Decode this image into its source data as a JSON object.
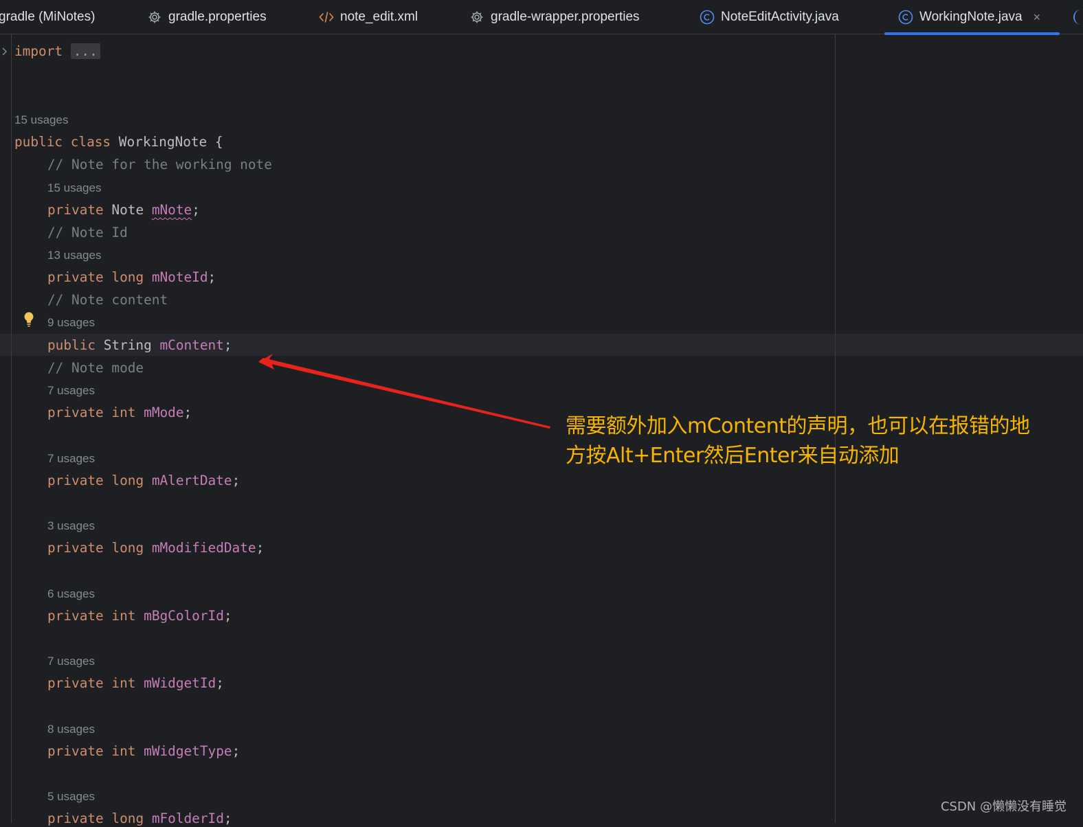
{
  "tabs": [
    {
      "label": "gradle (MiNotes)",
      "icon": "none",
      "active": false
    },
    {
      "label": "gradle.properties",
      "icon": "gear-icon",
      "active": false
    },
    {
      "label": "note_edit.xml",
      "icon": "xml-tag-icon",
      "active": false
    },
    {
      "label": "gradle-wrapper.properties",
      "icon": "gear-icon",
      "active": false
    },
    {
      "label": "NoteEditActivity.java",
      "icon": "java-class-icon",
      "active": false
    },
    {
      "label": "WorkingNote.java",
      "icon": "java-class-icon",
      "active": true,
      "close": "×"
    }
  ],
  "editor": {
    "import_keyword": "import",
    "import_folded": "...",
    "class_usages": "15 usages",
    "class_decl": {
      "mod": "public",
      "kw": "class",
      "name": "WorkingNote",
      "brace": " {"
    },
    "members": [
      {
        "comment": "// Note for the working note",
        "usages": "15 usages",
        "mod": "private",
        "type": "Note",
        "name": "mNote"
      },
      {
        "comment": "// Note Id",
        "usages": "13 usages",
        "mod": "private",
        "type": "long",
        "name": "mNoteId"
      },
      {
        "comment": "// Note content",
        "usages": "9 usages",
        "mod": "public",
        "type": "String",
        "name": "mContent"
      },
      {
        "comment": "// Note mode",
        "usages": "7 usages",
        "mod": "private",
        "type": "int",
        "name": "mMode"
      },
      {
        "comment": "",
        "usages": "7 usages",
        "mod": "private",
        "type": "long",
        "name": "mAlertDate"
      },
      {
        "comment": "",
        "usages": "3 usages",
        "mod": "private",
        "type": "long",
        "name": "mModifiedDate"
      },
      {
        "comment": "",
        "usages": "6 usages",
        "mod": "private",
        "type": "int",
        "name": "mBgColorId"
      },
      {
        "comment": "",
        "usages": "7 usages",
        "mod": "private",
        "type": "int",
        "name": "mWidgetId"
      },
      {
        "comment": "",
        "usages": "8 usages",
        "mod": "private",
        "type": "int",
        "name": "mWidgetType"
      },
      {
        "comment": "",
        "usages": "5 usages",
        "mod": "private",
        "type": "long",
        "name": "mFolderId"
      }
    ],
    "semicolon": ";"
  },
  "annotation": {
    "line1": "需要额外加入mContent的声明，也可以在报错的地",
    "line2": "方按Alt+Enter然后Enter来自动添加",
    "color": "#f5b400",
    "arrow_color": "#e8231c"
  },
  "watermark": "CSDN @懒懒没有睡觉",
  "colors": {
    "background": "#1e1f22",
    "keyword": "#cf8e6d",
    "field": "#c77dbb",
    "comment": "#7a7e85",
    "text": "#bcbec4",
    "accent": "#3574f0"
  }
}
